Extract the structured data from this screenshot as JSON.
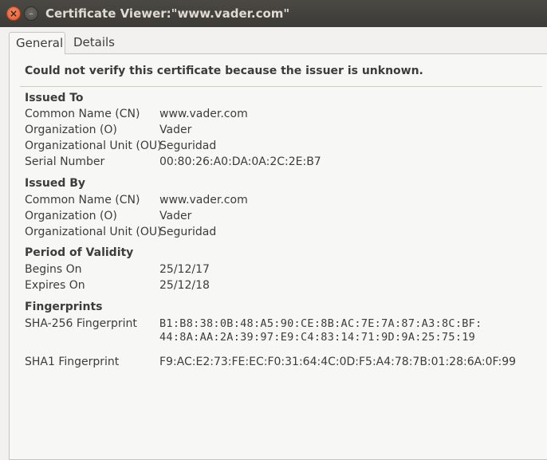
{
  "window": {
    "title": "Certificate Viewer:\"www.vader.com\"",
    "close_glyph": "×",
    "minimize_glyph": "–"
  },
  "tabs": [
    {
      "label": "General",
      "selected": true
    },
    {
      "label": "Details",
      "selected": false
    }
  ],
  "warning": "Could not verify this certificate because the issuer is unknown.",
  "issued_to": {
    "title": "Issued To",
    "rows": [
      {
        "label": "Common Name (CN)",
        "value": "www.vader.com"
      },
      {
        "label": "Organization (O)",
        "value": "Vader"
      },
      {
        "label": "Organizational Unit (OU)",
        "value": "Seguridad"
      },
      {
        "label": "Serial Number",
        "value": "00:80:26:A0:DA:0A:2C:2E:B7"
      }
    ]
  },
  "issued_by": {
    "title": "Issued By",
    "rows": [
      {
        "label": "Common Name (CN)",
        "value": "www.vader.com"
      },
      {
        "label": "Organization (O)",
        "value": "Vader"
      },
      {
        "label": "Organizational Unit (OU)",
        "value": "Seguridad"
      }
    ]
  },
  "validity": {
    "title": "Period of Validity",
    "rows": [
      {
        "label": "Begins On",
        "value": "25/12/17"
      },
      {
        "label": "Expires On",
        "value": "25/12/18"
      }
    ]
  },
  "fingerprints": {
    "title": "Fingerprints",
    "sha256": {
      "label": "SHA-256 Fingerprint",
      "line1": "B1:B8:38:0B:48:A5:90:CE:8B:AC:7E:7A:87:A3:8C:BF:",
      "line2": "44:8A:AA:2A:39:97:E9:C4:83:14:71:9D:9A:25:75:19"
    },
    "sha1": {
      "label": "SHA1 Fingerprint",
      "value": "F9:AC:E2:73:FE:EC:F0:31:64:4C:0D:F5:A4:78:7B:01:28:6A:0F:99"
    }
  }
}
